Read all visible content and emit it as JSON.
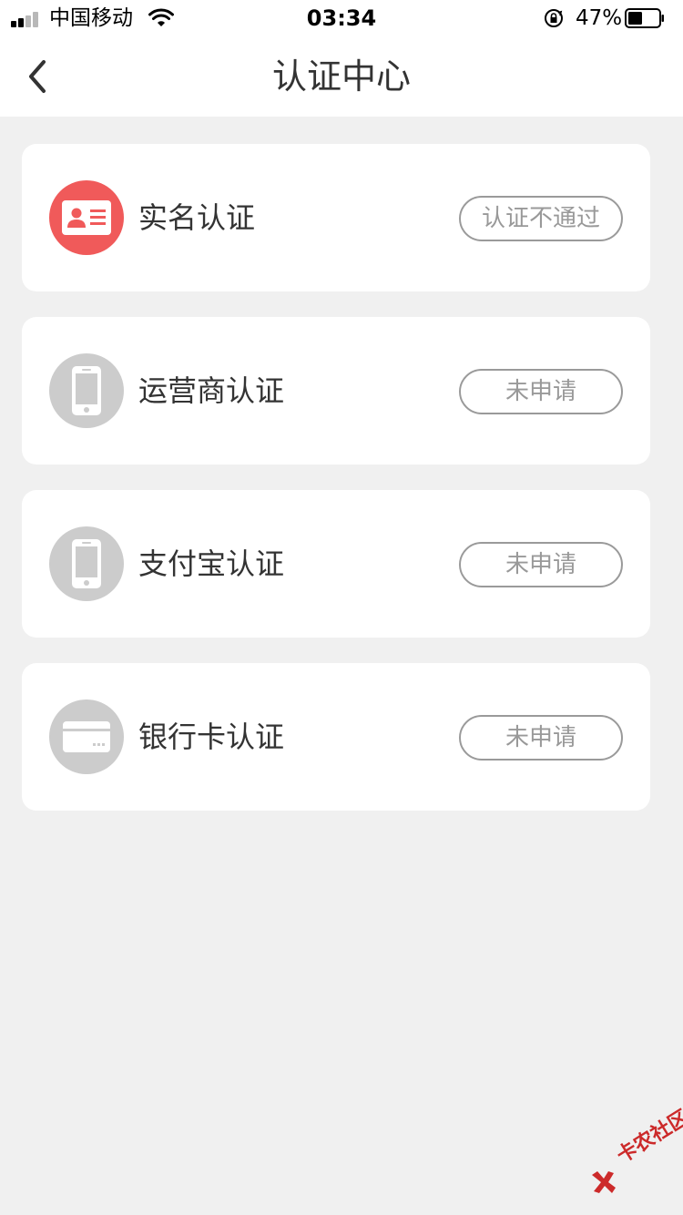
{
  "status_bar": {
    "carrier": "中国移动",
    "time": "03:34",
    "battery_percent": "47%",
    "battery_level": 0.47
  },
  "nav": {
    "title": "认证中心",
    "back_icon": "chevron-left-icon"
  },
  "cards": [
    {
      "label": "实名认证",
      "status": "认证不通过",
      "icon": "id-card-icon",
      "icon_color": "#f05a5a"
    },
    {
      "label": "运营商认证",
      "status": "未申请",
      "icon": "phone-icon",
      "icon_color": "#cccccc"
    },
    {
      "label": "支付宝认证",
      "status": "未申请",
      "icon": "phone-icon",
      "icon_color": "#cccccc"
    },
    {
      "label": "银行卡认证",
      "status": "未申请",
      "icon": "bank-card-icon",
      "icon_color": "#cccccc"
    }
  ],
  "watermark": {
    "text": "卡农社区"
  },
  "colors": {
    "background": "#f0f0f0",
    "card": "#ffffff",
    "accent_red": "#f05a5a",
    "text_primary": "#333333",
    "text_muted": "#999999"
  }
}
